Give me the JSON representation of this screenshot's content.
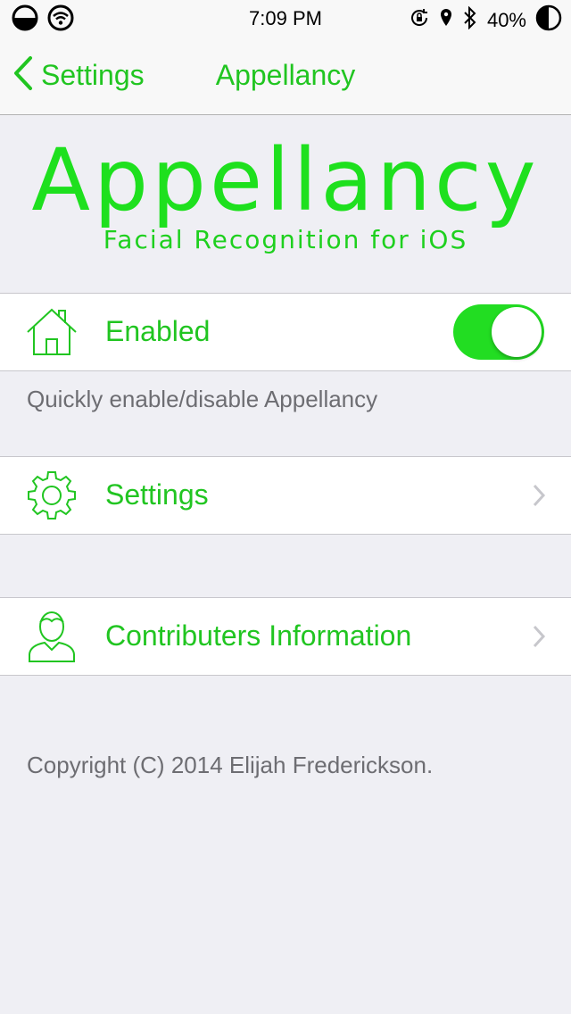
{
  "status_bar": {
    "time": "7:09 PM",
    "battery_percent": "40%",
    "icons": [
      "signal-icon",
      "wifi-icon",
      "rotation-lock-icon",
      "location-icon",
      "bluetooth-icon",
      "battery-icon"
    ]
  },
  "nav": {
    "back_label": "Settings",
    "title": "Appellancy"
  },
  "header": {
    "app_name": "Appellancy",
    "tagline": "Facial Recognition for iOS"
  },
  "enabled_row": {
    "label": "Enabled",
    "icon": "home-icon",
    "toggle_on": true,
    "footer": "Quickly enable/disable Appellancy"
  },
  "settings_row": {
    "label": "Settings",
    "icon": "gear-icon"
  },
  "contributors_row": {
    "label": "Contributers Information",
    "icon": "person-icon"
  },
  "copyright": "Copyright (C) 2014 Elijah Frederickson.",
  "colors": {
    "accent": "#21c521",
    "toggle_on": "#22dd22",
    "background": "#efeff4",
    "secondary_text": "#6d6d72"
  }
}
